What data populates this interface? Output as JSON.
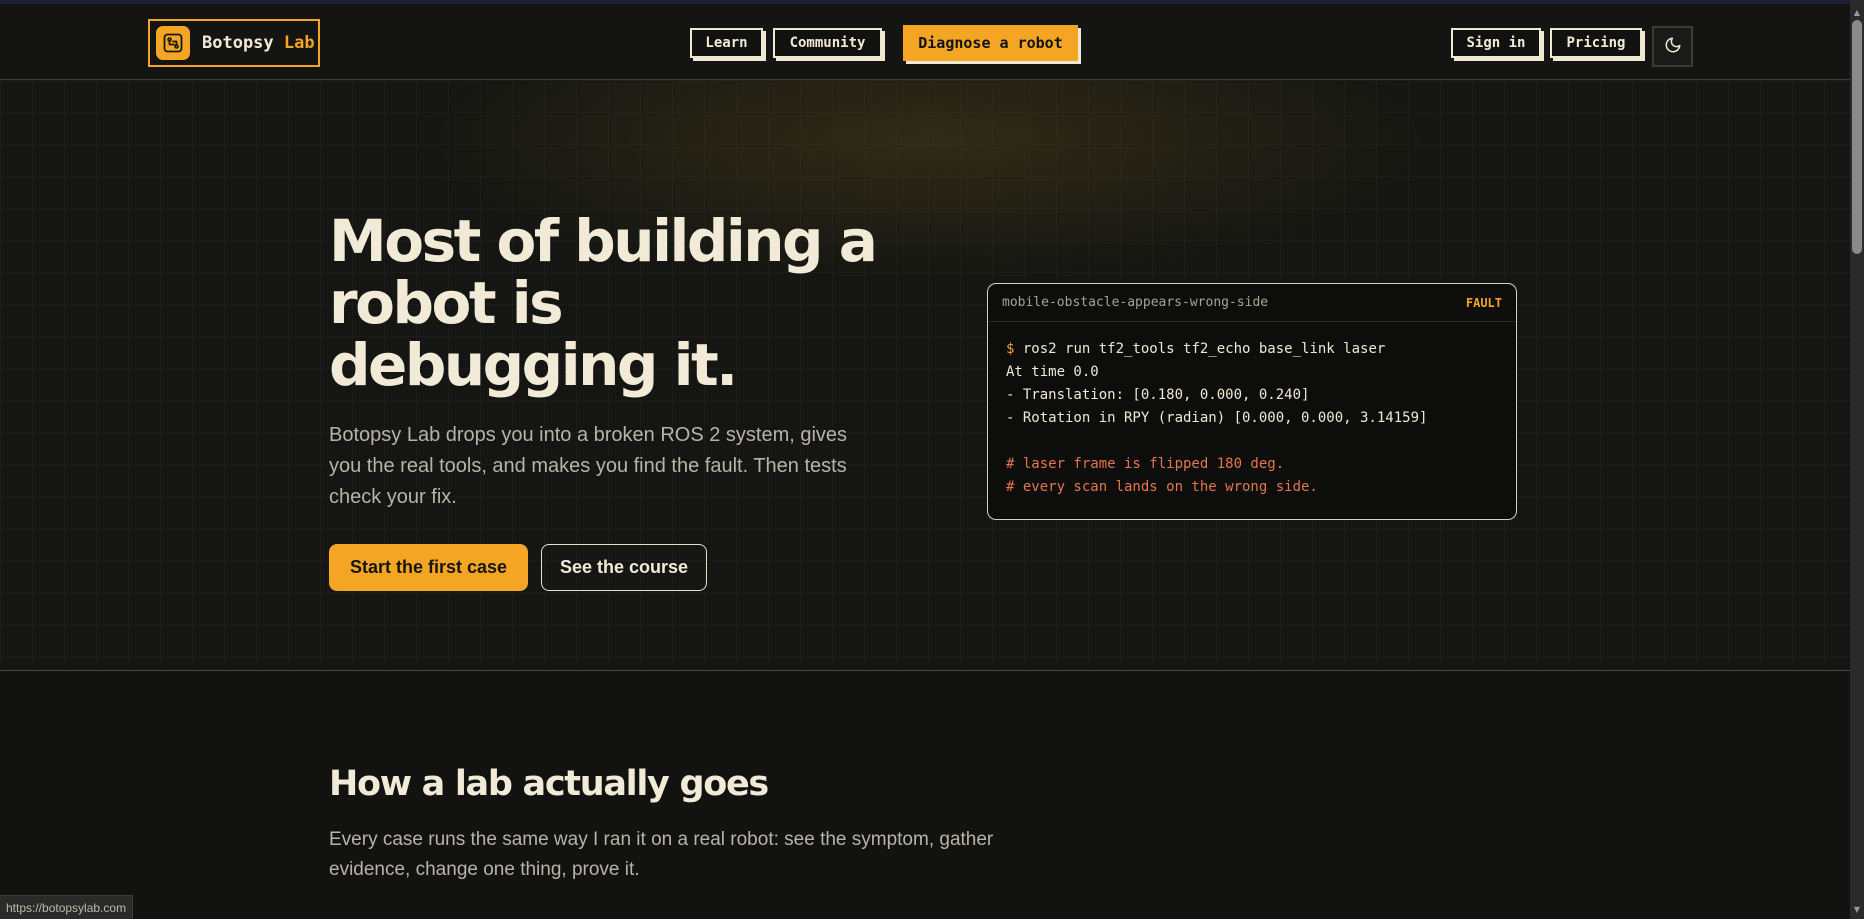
{
  "brand": {
    "name_part1": "Botopsy",
    "name_part2": "Lab",
    "accent_color": "#f5a524"
  },
  "nav": {
    "learn": "Learn",
    "community": "Community",
    "diagnose": "Diagnose a robot",
    "sign_in": "Sign in",
    "pricing": "Pricing",
    "theme_icon": "moon-icon"
  },
  "hero": {
    "title": "Most of building a robot is debugging it.",
    "subtitle": "Botopsy Lab drops you into a broken ROS 2 system, gives you the real tools, and makes you find the fault. Then tests check your fix.",
    "primary_cta": "Start the first case",
    "secondary_cta": "See the course"
  },
  "terminal": {
    "case_name": "mobile-obstacle-appears-wrong-side",
    "status": "FAULT",
    "prompt_symbol": "$",
    "command": "ros2 run tf2_tools tf2_echo base_link laser",
    "output": [
      "At time 0.0",
      "- Translation: [0.180, 0.000, 0.240]",
      "- Rotation in RPY (radian) [0.000, 0.000, 3.14159]"
    ],
    "comments": [
      "# laser frame is flipped 180 deg.",
      "# every scan lands on the wrong side."
    ]
  },
  "section": {
    "title": "How a lab actually goes",
    "subtitle": "Every case runs the same way I ran it on a real robot: see the symptom, gather evidence, change one thing, prove it."
  },
  "status_bar": {
    "url": "https://botopsylab.com"
  }
}
